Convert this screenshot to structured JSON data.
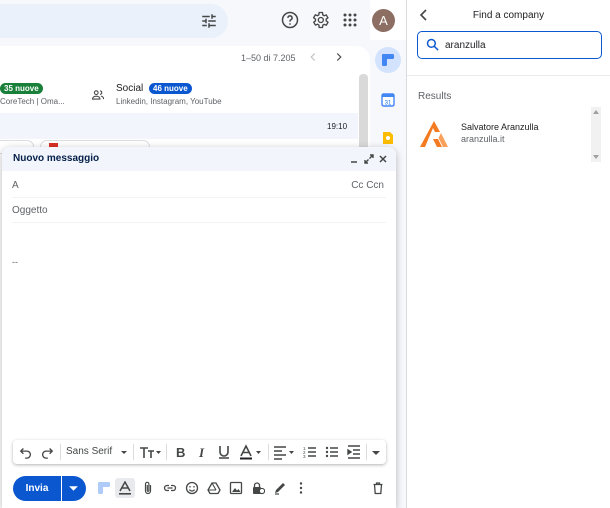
{
  "gmail": {
    "avatar_letter": "A",
    "pager": "1–50 di 7.205",
    "categories": [
      {
        "badge": "35 nuove",
        "badge_color": "#188038",
        "subtitle": "CoreTech | Oma..."
      },
      {
        "title": "Social",
        "badge": "46 nuove",
        "badge_color": "#0b57d0",
        "subtitle": "Linkedin, Instagram, YouTube"
      }
    ],
    "row_time": "19:10"
  },
  "compose": {
    "title": "Nuovo messaggio",
    "to_label": "A",
    "cc_label": "Cc Ccn",
    "subject_placeholder": "Oggetto",
    "signature": "--",
    "font_name": "Sans Serif",
    "send_label": "Invia"
  },
  "panel": {
    "title": "Find a company",
    "search_value": "aranzulla",
    "results_label": "Results",
    "results": [
      {
        "name": "Salvatore Aranzulla",
        "url": "aranzulla.it"
      }
    ]
  },
  "colors": {
    "accent": "#0b57d0",
    "brand_orange": "#f47b20"
  }
}
